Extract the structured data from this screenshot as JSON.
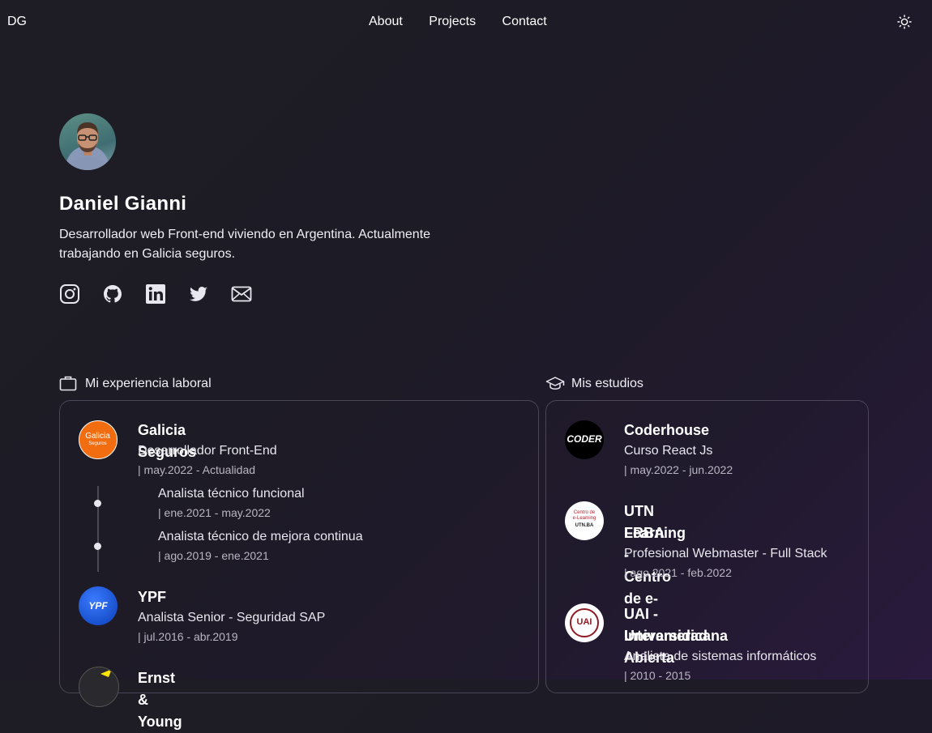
{
  "nav": {
    "logo": "DG",
    "links": [
      "About",
      "Projects",
      "Contact"
    ],
    "theme_icon": "sun-icon"
  },
  "profile": {
    "name": "Daniel Gianni",
    "bio": "Desarrollador web Front-end viviendo en Argentina. Actualmente trabajando en Galicia seguros.",
    "socials": [
      "instagram-icon",
      "github-icon",
      "linkedin-icon",
      "twitter-icon",
      "mail-icon"
    ]
  },
  "experience": {
    "title": "Mi experiencia laboral",
    "items": [
      {
        "company": "Galicia Seguros",
        "role": "Desarrollador Front-End",
        "date": "| may.2022 - Actualidad",
        "logo_text": "Galicia",
        "logo_sub": "Seguros",
        "color": "#f26c10",
        "sub": [
          {
            "role": "Analista técnico funcional",
            "date": "| ene.2021 - may.2022"
          },
          {
            "role": "Analista técnico de mejora continua",
            "date": "| ago.2019 - ene.2021"
          }
        ]
      },
      {
        "company": "YPF",
        "role": "Analista Senior - Seguridad SAP",
        "date": "| jul.2016 - abr.2019",
        "logo_text": "YPF",
        "color": "#1f5fe0"
      },
      {
        "company": "Ernst & Young"
      }
    ]
  },
  "studies": {
    "title": "Mis estudios",
    "items": [
      {
        "school": "Coderhouse",
        "course": "Curso React Js",
        "date": "| may.2022 - jun.2022",
        "logo_text": "CODER"
      },
      {
        "school_line1": "UTN FRBA - Centro de e-",
        "school_line2": "Learning",
        "course": "Profesional Webmaster - Full Stack",
        "date": "| ago.2021 - feb.2022",
        "logo_text1": "Centro de",
        "logo_text2": "e-Learning",
        "logo_text3": "UTN.BA"
      },
      {
        "school_line1": "UAI - Universidad Abierta",
        "school_line2": "Interamericana",
        "course": "Analista de sistemas informáticos",
        "date": "| 2010 - 2015",
        "logo_text": "UAI",
        "color": "#8e1b24"
      }
    ]
  }
}
